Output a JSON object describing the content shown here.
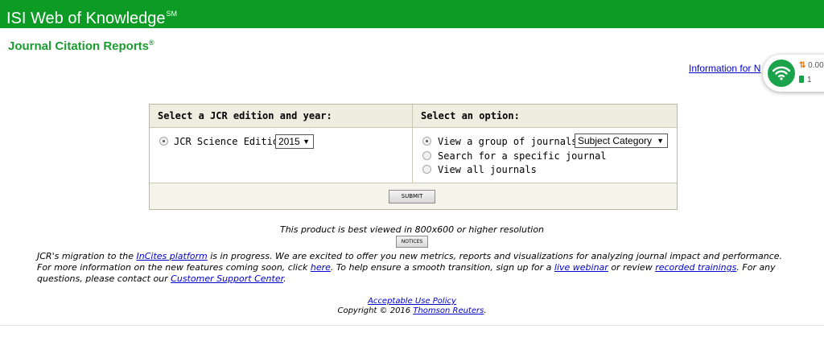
{
  "header": {
    "brand": "ISI Web of Knowledge",
    "brand_mark": "SM",
    "brand_color": "#0c9b24"
  },
  "product": {
    "title": "Journal Citation Reports",
    "mark": "®"
  },
  "info_link": "Information for N",
  "network_widget": {
    "icon": "wifi-icon",
    "speed": "0.00",
    "count": "1"
  },
  "form": {
    "left_header": "Select a JCR edition and year:",
    "right_header": "Select an option:",
    "edition_label": "JCR Science Edition",
    "year_value": "2015",
    "options": [
      "View a group of journals by",
      "Search for a specific journal",
      "View all journals"
    ],
    "group_by_value": "Subject Category",
    "submit_label": "SUBMIT"
  },
  "best_viewed": "This product is best viewed in 800x600 or higher resolution",
  "notices_label": "NOTICES",
  "migration": {
    "t1": "JCR's migration to the ",
    "link_incites": "InCites platform",
    "t2": " is in progress. We are excited to offer you new metrics, reports and visualizations for analyzing journal impact and performance. For more information on the new features coming soon, click ",
    "link_here": "here",
    "t3": ". To help ensure a smooth transition, sign up for a ",
    "link_webinar": "live webinar",
    "t4": " or review ",
    "link_trainings": "recorded trainings",
    "t5": ". For any questions, please contact our ",
    "link_support": "Customer Support Center",
    "t6": "."
  },
  "footer": {
    "acceptable_use": "Acceptable Use Policy",
    "copyright": "Copyright © 2016 ",
    "company": "Thomson Reuters",
    "period": "."
  }
}
